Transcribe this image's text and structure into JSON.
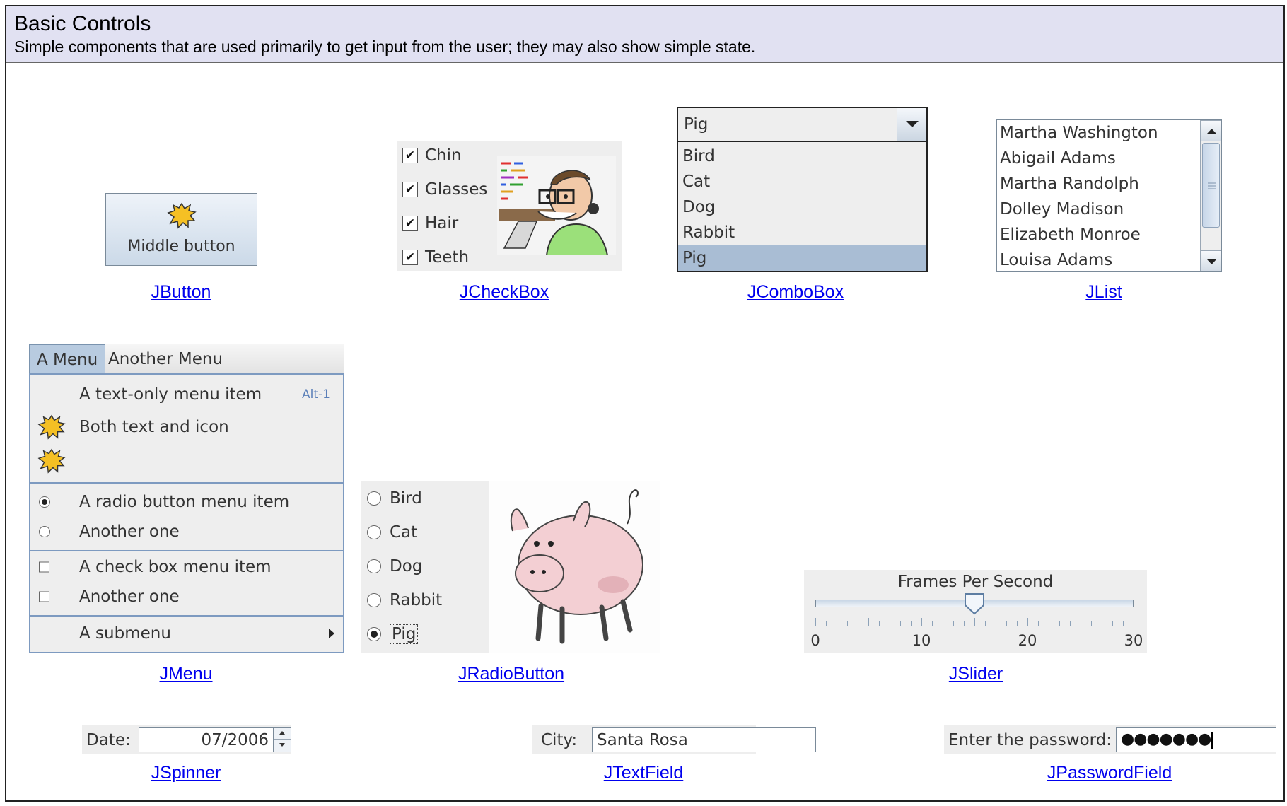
{
  "header": {
    "title": "Basic Controls",
    "description": "Simple components that are used primarily to get input from the user; they may also show simple state."
  },
  "captions": {
    "jbutton": "JButton",
    "jcheckbox": "JCheckBox",
    "jcombobox": "JComboBox",
    "jlist": "JList",
    "jmenu": "JMenu",
    "jradiobutton": "JRadioButton",
    "jslider": "JSlider",
    "jspinner": "JSpinner",
    "jtextfield": "JTextField",
    "jpasswordfield": "JPasswordField"
  },
  "button": {
    "label": "Middle button",
    "icon": "burst-icon"
  },
  "checkbox": {
    "items": [
      {
        "label": "Chin",
        "checked": true
      },
      {
        "label": "Glasses",
        "checked": true
      },
      {
        "label": "Hair",
        "checked": true
      },
      {
        "label": "Teeth",
        "checked": true
      }
    ],
    "check_glyph": "✔"
  },
  "combobox": {
    "selected": "Pig",
    "options": [
      "Bird",
      "Cat",
      "Dog",
      "Rabbit",
      "Pig"
    ],
    "highlighted": "Pig"
  },
  "list": {
    "items": [
      "Martha Washington",
      "Abigail Adams",
      "Martha Randolph",
      "Dolley Madison",
      "Elizabeth Monroe",
      "Louisa Adams"
    ]
  },
  "menu": {
    "titles": [
      "A Menu",
      "Another Menu"
    ],
    "items": {
      "text_only": "A text-only menu item",
      "text_only_accel": "Alt-1",
      "text_icon": "Both text and icon",
      "radio1": "A radio button menu item",
      "radio2": "Another one",
      "check1": "A check box menu item",
      "check2": "Another one",
      "submenu": "A submenu"
    }
  },
  "radio": {
    "items": [
      "Bird",
      "Cat",
      "Dog",
      "Rabbit",
      "Pig"
    ],
    "selected": "Pig"
  },
  "slider": {
    "title": "Frames Per Second",
    "min": 0,
    "max": 30,
    "value": 15,
    "labels": [
      "0",
      "10",
      "20",
      "30"
    ]
  },
  "spinner": {
    "label": "Date:",
    "value": "07/2006"
  },
  "textfield": {
    "label": "City:",
    "value": "Santa Rosa"
  },
  "password": {
    "label": "Enter the password:",
    "value": "●●●●●●●"
  },
  "colors": {
    "accent": "#b8cbe0",
    "link": "#0000ee",
    "header_bg": "#e1e1f2"
  }
}
